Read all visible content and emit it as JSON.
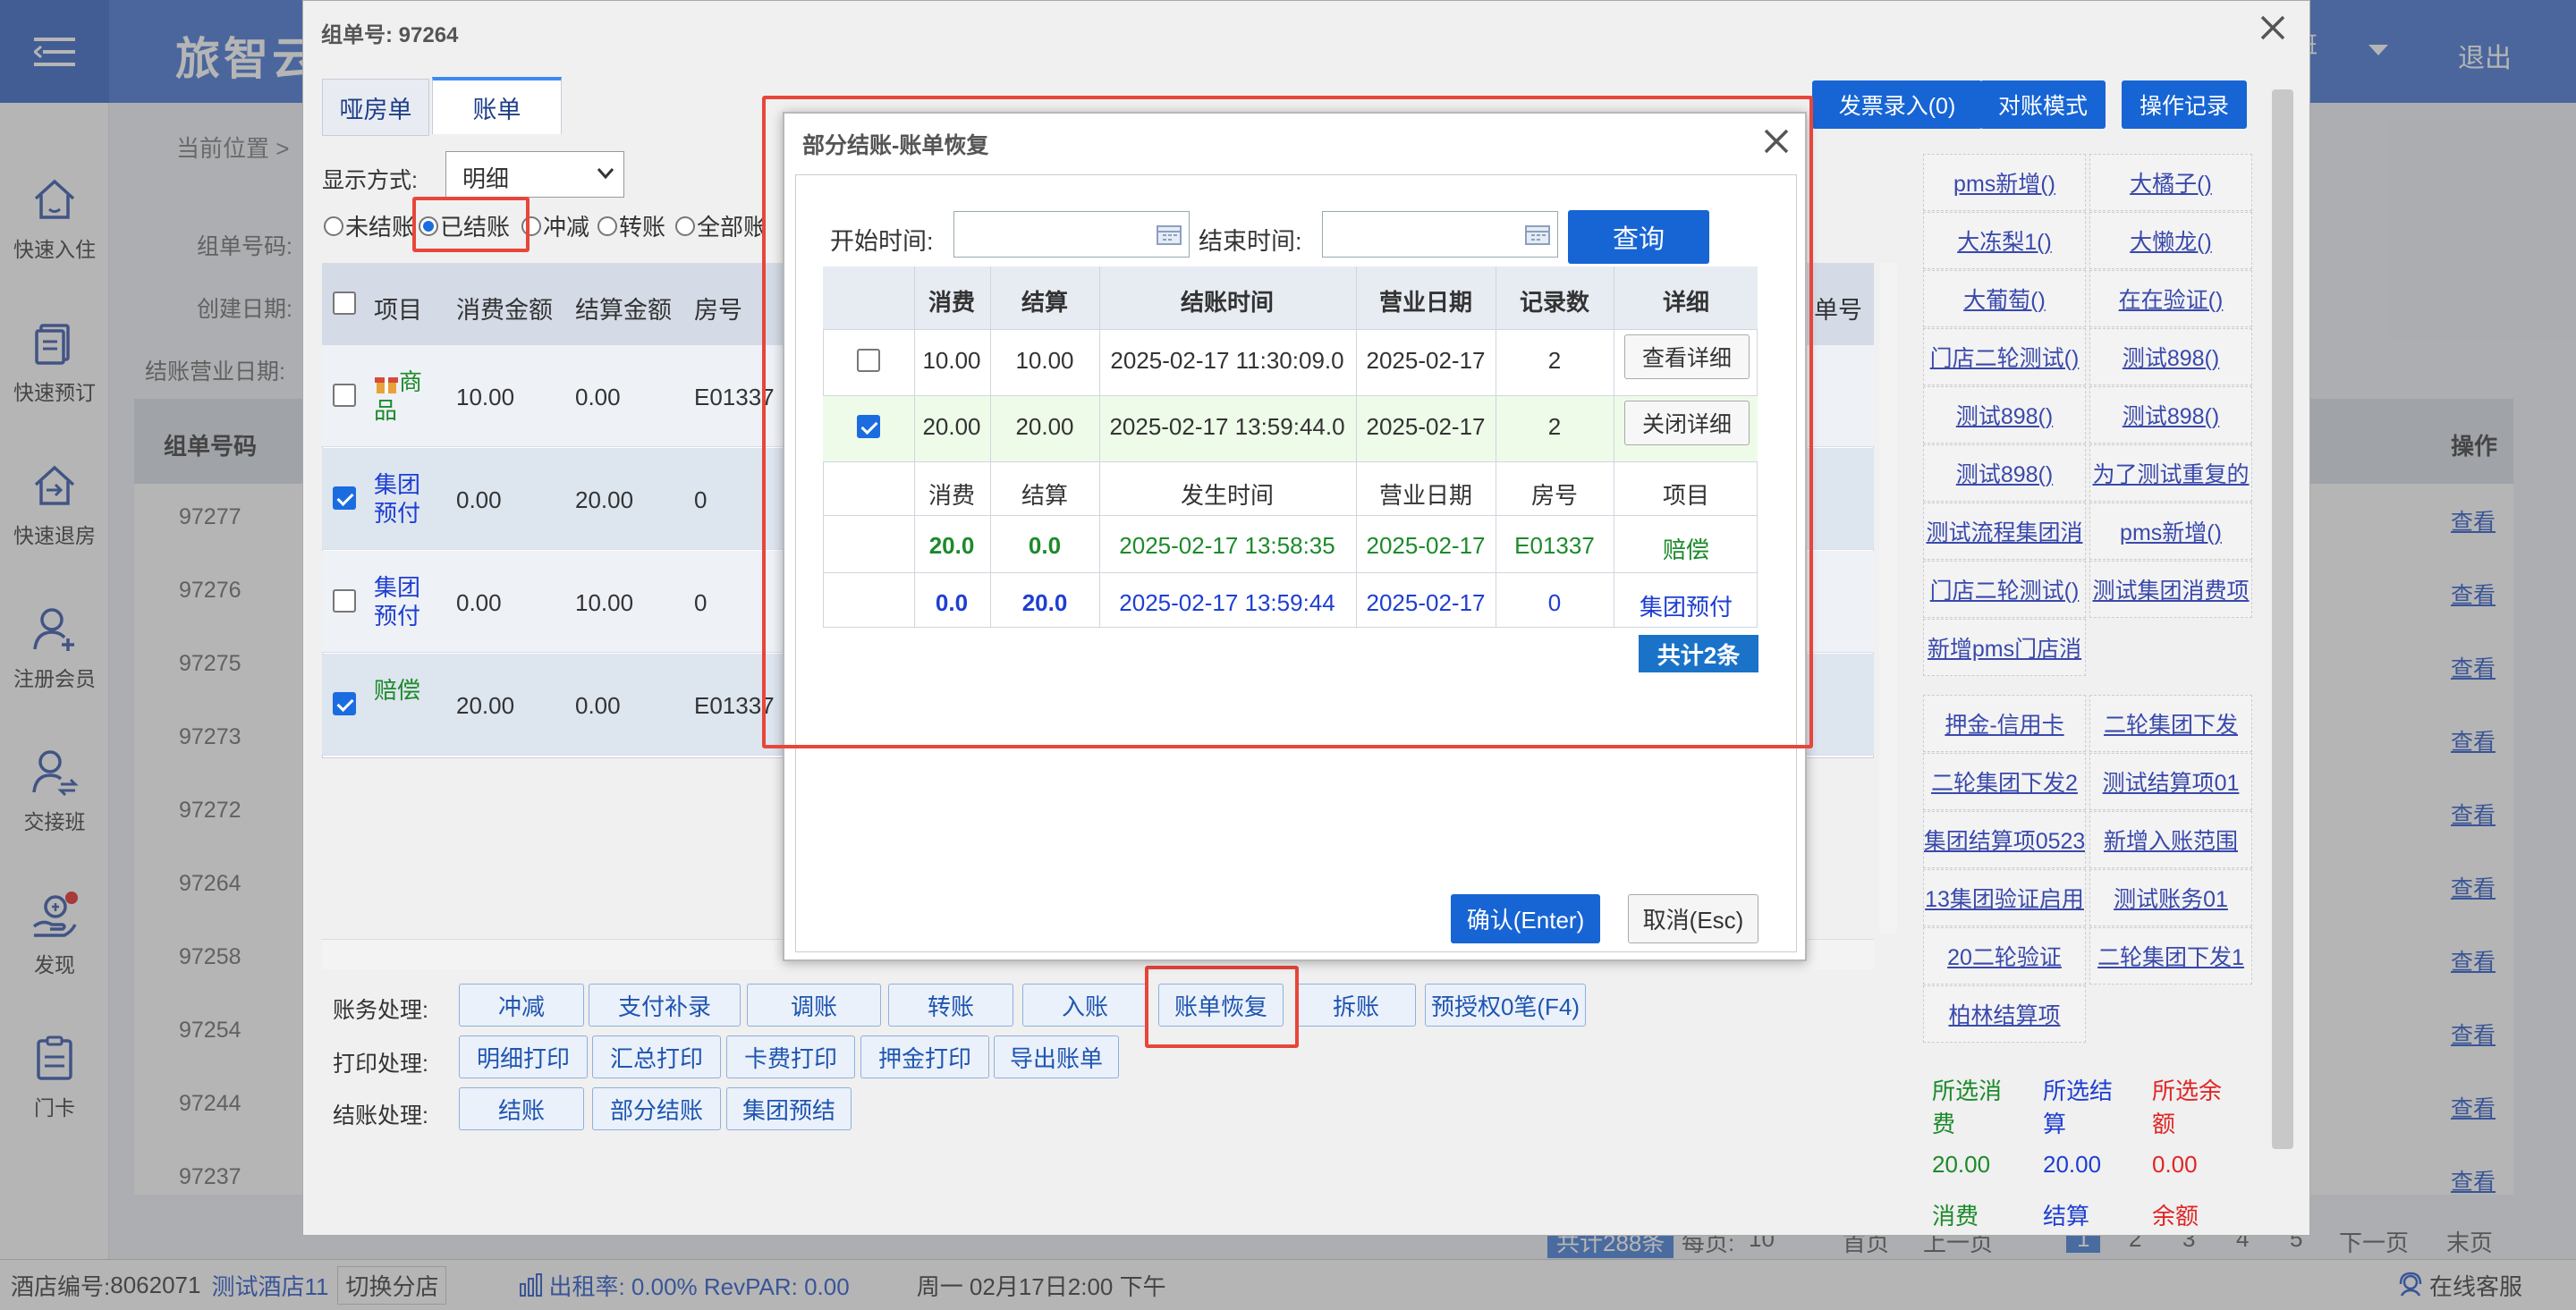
{
  "app": {
    "brand": "旅智云",
    "logout": "退出",
    "user": "班"
  },
  "sidebar": {
    "items": [
      {
        "label": "快速入住",
        "icon": "house-icon"
      },
      {
        "label": "快速预订",
        "icon": "document-list-icon"
      },
      {
        "label": "快速退房",
        "icon": "house-exit-icon"
      },
      {
        "label": "注册会员",
        "icon": "user-add-icon"
      },
      {
        "label": "交接班",
        "icon": "user-swap-icon"
      },
      {
        "label": "发现",
        "icon": "hand-coin-icon"
      },
      {
        "label": "门卡",
        "icon": "clipboard-card-icon"
      }
    ]
  },
  "background": {
    "breadcrumb": "当前位置 >",
    "labels": [
      "组单号码:",
      "创建日期:",
      "结账营业日期:"
    ],
    "column_group_no": "组单号码",
    "column_ops": "操作",
    "group_ids": [
      "97277",
      "97276",
      "97275",
      "97273",
      "97272",
      "97264",
      "97258",
      "97254",
      "97244",
      "97237"
    ],
    "view_label": "查看",
    "pager": {
      "total": "共计288条",
      "per_page_label": "每页:",
      "per_page": "10",
      "first": "首页",
      "prev": "上一页",
      "pages": [
        "1",
        "2",
        "3",
        "4",
        "5"
      ],
      "next": "下一页",
      "last": "末页"
    }
  },
  "statusbar": {
    "hotel_no_label": "酒店编号:",
    "hotel_no": "8062071",
    "hotel_name": "测试酒店11",
    "switch_branch": "切换分店",
    "occupancy": "出租率: 0.00% RevPAR: 0.00",
    "datetime": "周一 02月17日2:00 下午",
    "online_service": "在线客服"
  },
  "group_modal": {
    "title": "组单号: 97264",
    "tabs": [
      "哑房单",
      "账单"
    ],
    "top_buttons": [
      "发票录入(0)",
      "对账模式",
      "操作记录"
    ],
    "display_mode_label": "显示方式:",
    "display_mode_value": "明细",
    "radio_options": [
      "未结账",
      "已结账",
      "冲减",
      "转账",
      "全部账"
    ],
    "radio_selected": 1,
    "table_headers": [
      "项目",
      "消费金额",
      "结算金额",
      "房号"
    ],
    "extra_header": "单号",
    "rows": [
      {
        "item": "商品",
        "consume": "10.00",
        "settle": "0.00",
        "room": "E01337",
        "checked": false,
        "color": "green"
      },
      {
        "item": "集团预付",
        "consume": "0.00",
        "settle": "20.00",
        "room": "0",
        "checked": true,
        "color": "blue"
      },
      {
        "item": "集团预付",
        "consume": "0.00",
        "settle": "10.00",
        "room": "0",
        "checked": false,
        "color": "blue"
      },
      {
        "item": "赔偿",
        "consume": "20.00",
        "settle": "0.00",
        "room": "E01337",
        "checked": true,
        "color": "green"
      }
    ],
    "account_label": "账务处理:",
    "account_buttons": [
      "冲减",
      "支付补录",
      "调账",
      "转账",
      "入账",
      "账单恢复",
      "拆账",
      "预授权0笔(F4)"
    ],
    "print_label": "打印处理:",
    "print_buttons": [
      "明细打印",
      "汇总打印",
      "卡费打印",
      "押金打印",
      "导出账单"
    ],
    "checkout_label": "结账处理:",
    "checkout_buttons": [
      "结账",
      "部分结账",
      "集团预结"
    ],
    "right_links": [
      "pms新增()",
      "大橘子()",
      "大冻梨1()",
      "大懒龙()",
      "大葡萄()",
      "在在验证()",
      "门店二轮测试()",
      "测试898()",
      "测试898()",
      "测试898()",
      "测试898()",
      "为了测试重复的",
      "测试流程集团消",
      "pms新增()",
      "门店二轮测试()",
      "测试集团消费项",
      "新增pms门店消"
    ],
    "right_links2": [
      "押金-信用卡",
      "二轮集团下发",
      "二轮集团下发2",
      "测试结算项01",
      "集团结算项0523",
      "新增入账范围",
      "13集团验证启用",
      "测试账务01",
      "20二轮验证",
      "二轮集团下发1",
      "柏林结算项"
    ],
    "summary": {
      "labels": [
        "所选消费",
        "所选结算",
        "所选余额"
      ],
      "values": [
        "20.00",
        "20.00",
        "0.00"
      ],
      "footer": [
        "消费",
        "结算",
        "余额"
      ]
    }
  },
  "dialog": {
    "title": "部分结账-账单恢复",
    "start_label": "开始时间:",
    "end_label": "结束时间:",
    "start_value": "",
    "end_value": "",
    "query_button": "查询",
    "headers": [
      "消费",
      "结算",
      "结账时间",
      "营业日期",
      "记录数",
      "详细"
    ],
    "records": [
      {
        "consume": "10.00",
        "settle": "10.00",
        "time": "2025-02-17 11:30:09.0",
        "date": "2025-02-17",
        "count": "2",
        "action": "查看详细",
        "checked": false
      },
      {
        "consume": "20.00",
        "settle": "20.00",
        "time": "2025-02-17 13:59:44.0",
        "date": "2025-02-17",
        "count": "2",
        "action": "关闭详细",
        "checked": true
      }
    ],
    "detail_headers": [
      "消费",
      "结算",
      "发生时间",
      "营业日期",
      "房号",
      "项目"
    ],
    "details": [
      {
        "consume": "20.0",
        "settle": "0.0",
        "time": "2025-02-17 13:58:35",
        "date": "2025-02-17",
        "room": "E01337",
        "item": "赔偿",
        "color": "green"
      },
      {
        "consume": "0.0",
        "settle": "20.0",
        "time": "2025-02-17 13:59:44",
        "date": "2025-02-17",
        "room": "0",
        "item": "集团预付",
        "color": "blue"
      }
    ],
    "total_badge": "共计2条",
    "confirm": "确认(Enter)",
    "cancel": "取消(Esc)"
  },
  "colors": {
    "topbar": "#3d6fd1",
    "accent_red": "#e8463a",
    "primary_button": "#1765d5",
    "green": "#1c8a2a",
    "blue": "#1e3ed2",
    "red": "#e02525"
  }
}
